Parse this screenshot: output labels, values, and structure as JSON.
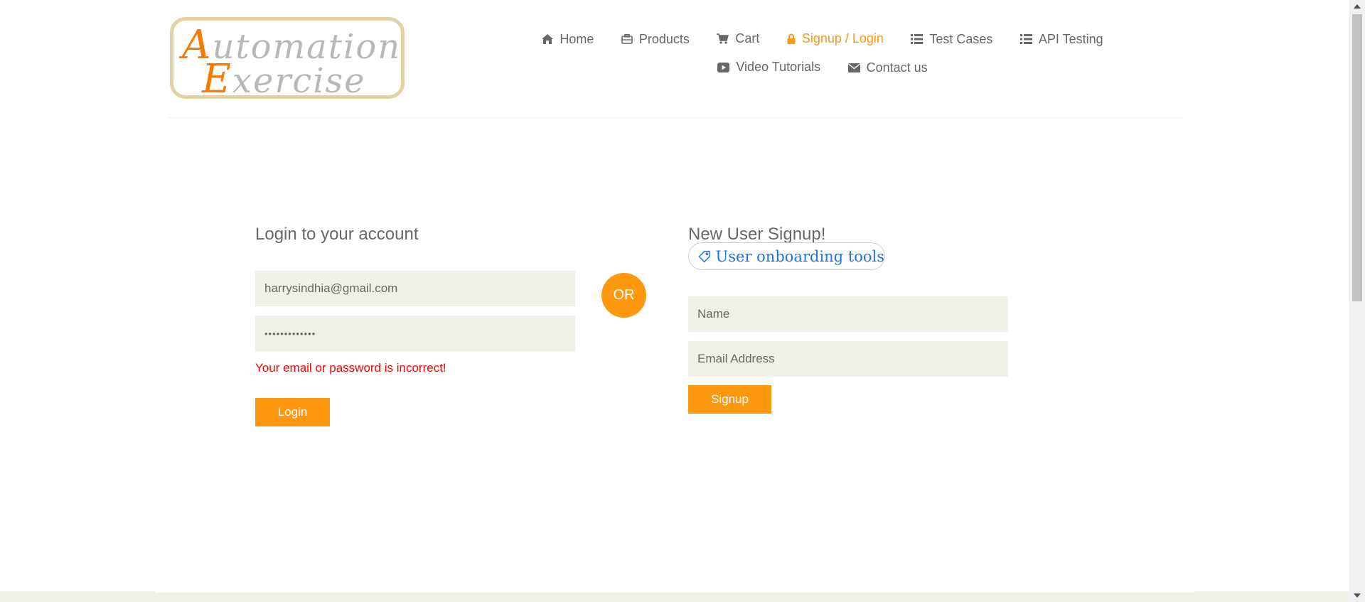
{
  "logo": {
    "line1_cap": "A",
    "line1_rest": "utomation",
    "line2_cap": "E",
    "line2_rest": "xercise"
  },
  "nav": {
    "items": [
      {
        "label": "Home",
        "icon": "home-icon"
      },
      {
        "label": "Products",
        "icon": "briefcase-icon"
      },
      {
        "label": "Cart",
        "icon": "cart-icon"
      },
      {
        "label": "Signup / Login",
        "icon": "lock-icon",
        "active": true
      },
      {
        "label": "Test Cases",
        "icon": "list-icon"
      },
      {
        "label": "API Testing",
        "icon": "list-icon"
      },
      {
        "label": "Video Tutorials",
        "icon": "youtube-play-icon"
      },
      {
        "label": "Contact us",
        "icon": "envelope-icon"
      }
    ]
  },
  "login": {
    "title": "Login to your account",
    "email_value": "harrysindhia@gmail.com",
    "password_value": "•••••••••••••",
    "error": "Your email or password is incorrect!",
    "button": "Login"
  },
  "divider": {
    "or_label": "OR"
  },
  "signup": {
    "title": "New User Signup!",
    "name_placeholder": "Name",
    "email_placeholder": "Email Address",
    "button": "Signup"
  },
  "extension_badge": {
    "label": "User onboarding tools",
    "icon": "tag-icon"
  },
  "colors": {
    "accent": "#fe980f",
    "text": "#696763",
    "field_bg": "#f0f0e9",
    "error": "#ff0000",
    "badge_text": "#1a73e8"
  }
}
